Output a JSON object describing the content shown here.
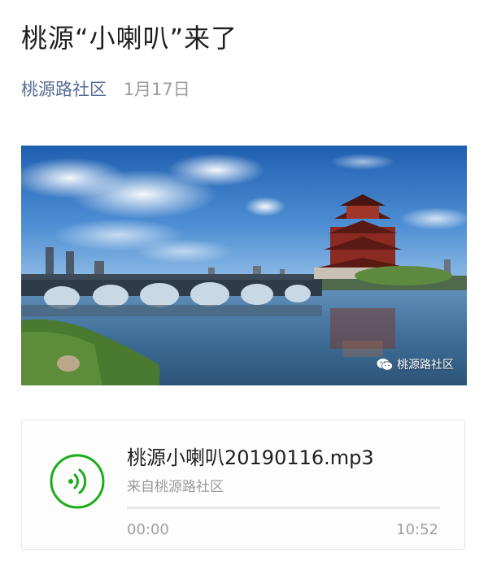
{
  "article": {
    "title": "桃源“小喇叭”来了",
    "account": "桃源路社区",
    "date": "1月17日"
  },
  "photo": {
    "watermark_icon": "wechat-icon",
    "watermark_text": "桃源路社区"
  },
  "audio": {
    "icon": "audio-play-icon",
    "filename": "桃源小喇叭20190116.mp3",
    "source": "来自桃源路社区",
    "current_time": "00:00",
    "total_time": "10:52",
    "progress": 0,
    "accent_color": "#1aad19"
  }
}
